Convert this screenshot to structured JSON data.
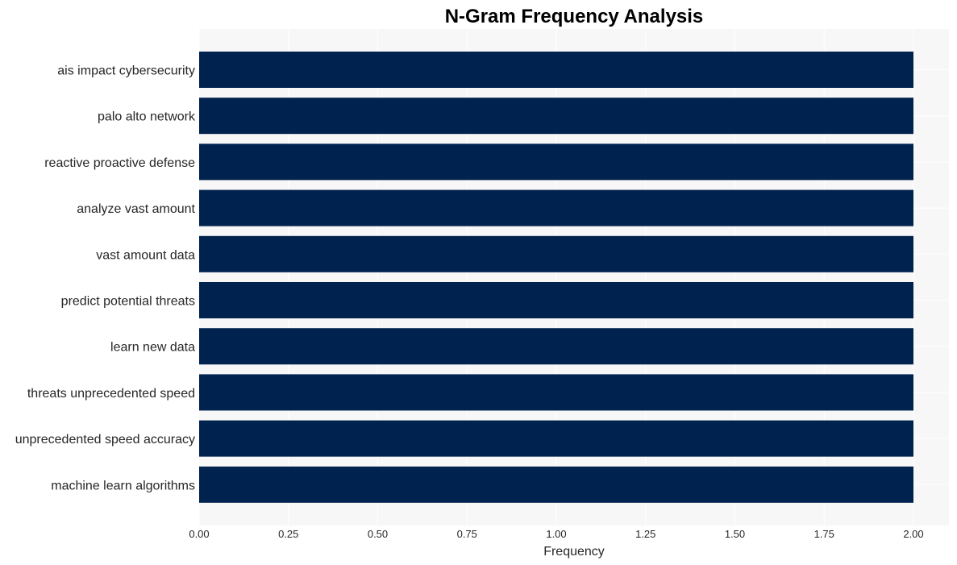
{
  "chart_data": {
    "type": "bar",
    "orientation": "horizontal",
    "title": "N-Gram Frequency Analysis",
    "xlabel": "Frequency",
    "ylabel": "",
    "categories": [
      "ais impact cybersecurity",
      "palo alto network",
      "reactive proactive defense",
      "analyze vast amount",
      "vast amount data",
      "predict potential threats",
      "learn new data",
      "threats unprecedented speed",
      "unprecedented speed accuracy",
      "machine learn algorithms"
    ],
    "values": [
      2,
      2,
      2,
      2,
      2,
      2,
      2,
      2,
      2,
      2
    ],
    "xlim": [
      0,
      2.1
    ],
    "xticks": [
      "0.00",
      "0.25",
      "0.50",
      "0.75",
      "1.00",
      "1.25",
      "1.50",
      "1.75",
      "2.00"
    ],
    "grid": true,
    "legend": "none",
    "colors": {
      "bar": "#00224e",
      "plot_background": "#f7f7f7",
      "grid": "#ffffff"
    }
  }
}
